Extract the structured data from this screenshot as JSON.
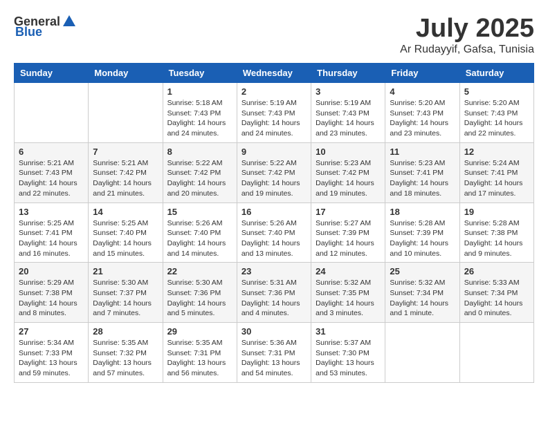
{
  "logo": {
    "general": "General",
    "blue": "Blue"
  },
  "header": {
    "month": "July 2025",
    "location": "Ar Rudayyif, Gafsa, Tunisia"
  },
  "days_of_week": [
    "Sunday",
    "Monday",
    "Tuesday",
    "Wednesday",
    "Thursday",
    "Friday",
    "Saturday"
  ],
  "weeks": [
    [
      {
        "day": "",
        "sunrise": "",
        "sunset": "",
        "daylight": ""
      },
      {
        "day": "",
        "sunrise": "",
        "sunset": "",
        "daylight": ""
      },
      {
        "day": "1",
        "sunrise": "Sunrise: 5:18 AM",
        "sunset": "Sunset: 7:43 PM",
        "daylight": "Daylight: 14 hours and 24 minutes."
      },
      {
        "day": "2",
        "sunrise": "Sunrise: 5:19 AM",
        "sunset": "Sunset: 7:43 PM",
        "daylight": "Daylight: 14 hours and 24 minutes."
      },
      {
        "day": "3",
        "sunrise": "Sunrise: 5:19 AM",
        "sunset": "Sunset: 7:43 PM",
        "daylight": "Daylight: 14 hours and 23 minutes."
      },
      {
        "day": "4",
        "sunrise": "Sunrise: 5:20 AM",
        "sunset": "Sunset: 7:43 PM",
        "daylight": "Daylight: 14 hours and 23 minutes."
      },
      {
        "day": "5",
        "sunrise": "Sunrise: 5:20 AM",
        "sunset": "Sunset: 7:43 PM",
        "daylight": "Daylight: 14 hours and 22 minutes."
      }
    ],
    [
      {
        "day": "6",
        "sunrise": "Sunrise: 5:21 AM",
        "sunset": "Sunset: 7:43 PM",
        "daylight": "Daylight: 14 hours and 22 minutes."
      },
      {
        "day": "7",
        "sunrise": "Sunrise: 5:21 AM",
        "sunset": "Sunset: 7:42 PM",
        "daylight": "Daylight: 14 hours and 21 minutes."
      },
      {
        "day": "8",
        "sunrise": "Sunrise: 5:22 AM",
        "sunset": "Sunset: 7:42 PM",
        "daylight": "Daylight: 14 hours and 20 minutes."
      },
      {
        "day": "9",
        "sunrise": "Sunrise: 5:22 AM",
        "sunset": "Sunset: 7:42 PM",
        "daylight": "Daylight: 14 hours and 19 minutes."
      },
      {
        "day": "10",
        "sunrise": "Sunrise: 5:23 AM",
        "sunset": "Sunset: 7:42 PM",
        "daylight": "Daylight: 14 hours and 19 minutes."
      },
      {
        "day": "11",
        "sunrise": "Sunrise: 5:23 AM",
        "sunset": "Sunset: 7:41 PM",
        "daylight": "Daylight: 14 hours and 18 minutes."
      },
      {
        "day": "12",
        "sunrise": "Sunrise: 5:24 AM",
        "sunset": "Sunset: 7:41 PM",
        "daylight": "Daylight: 14 hours and 17 minutes."
      }
    ],
    [
      {
        "day": "13",
        "sunrise": "Sunrise: 5:25 AM",
        "sunset": "Sunset: 7:41 PM",
        "daylight": "Daylight: 14 hours and 16 minutes."
      },
      {
        "day": "14",
        "sunrise": "Sunrise: 5:25 AM",
        "sunset": "Sunset: 7:40 PM",
        "daylight": "Daylight: 14 hours and 15 minutes."
      },
      {
        "day": "15",
        "sunrise": "Sunrise: 5:26 AM",
        "sunset": "Sunset: 7:40 PM",
        "daylight": "Daylight: 14 hours and 14 minutes."
      },
      {
        "day": "16",
        "sunrise": "Sunrise: 5:26 AM",
        "sunset": "Sunset: 7:40 PM",
        "daylight": "Daylight: 14 hours and 13 minutes."
      },
      {
        "day": "17",
        "sunrise": "Sunrise: 5:27 AM",
        "sunset": "Sunset: 7:39 PM",
        "daylight": "Daylight: 14 hours and 12 minutes."
      },
      {
        "day": "18",
        "sunrise": "Sunrise: 5:28 AM",
        "sunset": "Sunset: 7:39 PM",
        "daylight": "Daylight: 14 hours and 10 minutes."
      },
      {
        "day": "19",
        "sunrise": "Sunrise: 5:28 AM",
        "sunset": "Sunset: 7:38 PM",
        "daylight": "Daylight: 14 hours and 9 minutes."
      }
    ],
    [
      {
        "day": "20",
        "sunrise": "Sunrise: 5:29 AM",
        "sunset": "Sunset: 7:38 PM",
        "daylight": "Daylight: 14 hours and 8 minutes."
      },
      {
        "day": "21",
        "sunrise": "Sunrise: 5:30 AM",
        "sunset": "Sunset: 7:37 PM",
        "daylight": "Daylight: 14 hours and 7 minutes."
      },
      {
        "day": "22",
        "sunrise": "Sunrise: 5:30 AM",
        "sunset": "Sunset: 7:36 PM",
        "daylight": "Daylight: 14 hours and 5 minutes."
      },
      {
        "day": "23",
        "sunrise": "Sunrise: 5:31 AM",
        "sunset": "Sunset: 7:36 PM",
        "daylight": "Daylight: 14 hours and 4 minutes."
      },
      {
        "day": "24",
        "sunrise": "Sunrise: 5:32 AM",
        "sunset": "Sunset: 7:35 PM",
        "daylight": "Daylight: 14 hours and 3 minutes."
      },
      {
        "day": "25",
        "sunrise": "Sunrise: 5:32 AM",
        "sunset": "Sunset: 7:34 PM",
        "daylight": "Daylight: 14 hours and 1 minute."
      },
      {
        "day": "26",
        "sunrise": "Sunrise: 5:33 AM",
        "sunset": "Sunset: 7:34 PM",
        "daylight": "Daylight: 14 hours and 0 minutes."
      }
    ],
    [
      {
        "day": "27",
        "sunrise": "Sunrise: 5:34 AM",
        "sunset": "Sunset: 7:33 PM",
        "daylight": "Daylight: 13 hours and 59 minutes."
      },
      {
        "day": "28",
        "sunrise": "Sunrise: 5:35 AM",
        "sunset": "Sunset: 7:32 PM",
        "daylight": "Daylight: 13 hours and 57 minutes."
      },
      {
        "day": "29",
        "sunrise": "Sunrise: 5:35 AM",
        "sunset": "Sunset: 7:31 PM",
        "daylight": "Daylight: 13 hours and 56 minutes."
      },
      {
        "day": "30",
        "sunrise": "Sunrise: 5:36 AM",
        "sunset": "Sunset: 7:31 PM",
        "daylight": "Daylight: 13 hours and 54 minutes."
      },
      {
        "day": "31",
        "sunrise": "Sunrise: 5:37 AM",
        "sunset": "Sunset: 7:30 PM",
        "daylight": "Daylight: 13 hours and 53 minutes."
      },
      {
        "day": "",
        "sunrise": "",
        "sunset": "",
        "daylight": ""
      },
      {
        "day": "",
        "sunrise": "",
        "sunset": "",
        "daylight": ""
      }
    ]
  ]
}
